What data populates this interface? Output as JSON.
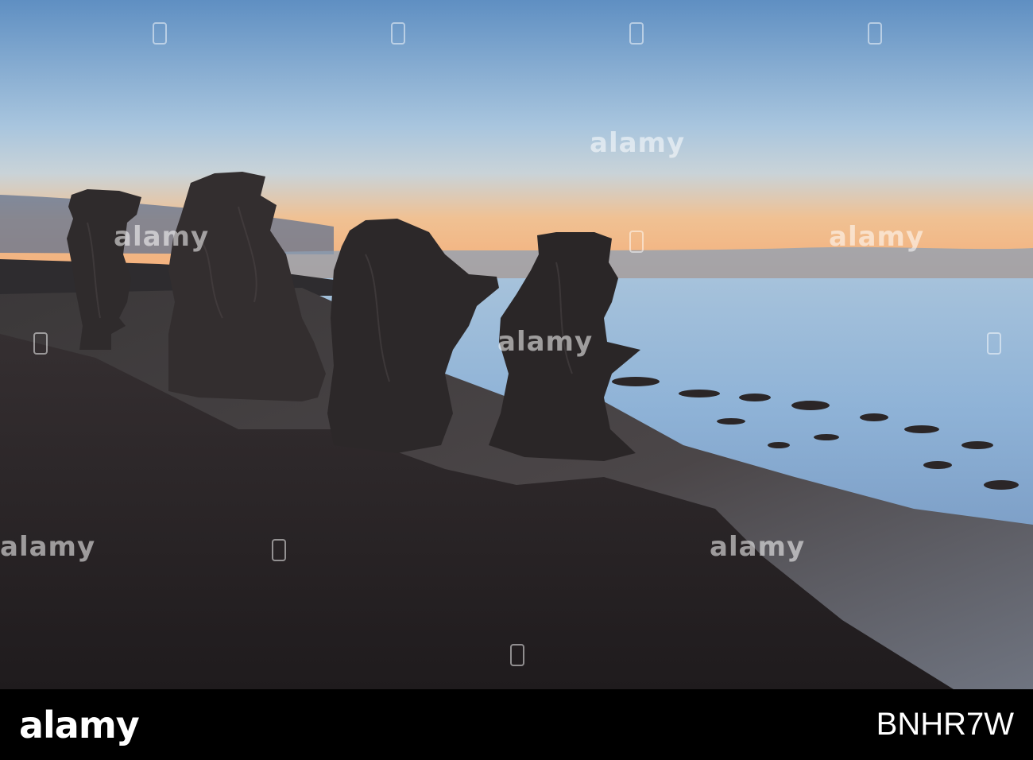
{
  "watermark": {
    "text": "alamy"
  },
  "footer": {
    "logo": "alamy",
    "image_id": "BNHR7W"
  },
  "colors": {
    "sky_top": "#6b98c8",
    "sky_mid": "#a9c6df",
    "horizon_glow": "#f3b27e",
    "sea": "#8db3d8",
    "rock": "#2d2a2a",
    "shore": "#3a3537",
    "footer_bg": "#000000"
  }
}
